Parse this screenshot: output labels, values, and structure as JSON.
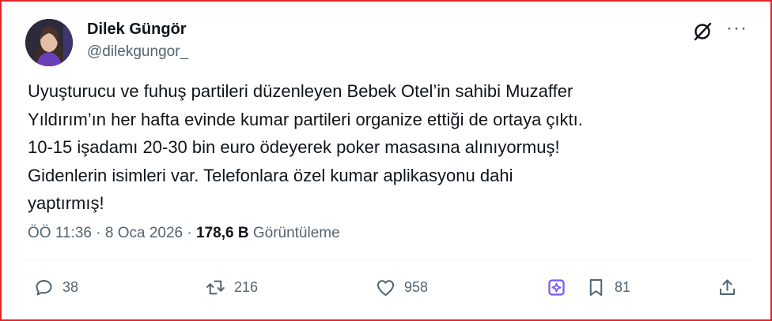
{
  "author": {
    "display_name": "Dilek Güngör",
    "handle": "@dilekgungor_"
  },
  "tweet": {
    "lines": [
      "Uyuşturucu ve fuhuş partileri düzenleyen Bebek Otel’in sahibi Muzaffer",
      "Yıldırım’ın her hafta evinde kumar partileri organize ettiği de ortaya çıktı.",
      "10-15 işadamı 20-30 bin euro ödeyerek poker masasına alınıyormuş!",
      "Gidenlerin isimleri var. Telefonlara özel kumar aplikasyonu dahi",
      "yaptırmış!"
    ]
  },
  "meta": {
    "time": "ÖÖ 11:36",
    "separator": "·",
    "date": "8 Oca 2026",
    "views_count": "178,6 B",
    "views_label": "Görüntüleme"
  },
  "actions": {
    "reply_count": "38",
    "retweet_count": "216",
    "like_count": "958",
    "bookmark_count": "81"
  },
  "icons": [
    "grok-icon",
    "more-icon",
    "reply-icon",
    "retweet-icon",
    "like-icon",
    "grok-share-icon",
    "bookmark-icon",
    "share-icon"
  ],
  "colors": {
    "frame_border": "#e3242b",
    "text_primary": "#0f1419",
    "text_secondary": "#536471",
    "accent_purple": "#7856ff"
  }
}
